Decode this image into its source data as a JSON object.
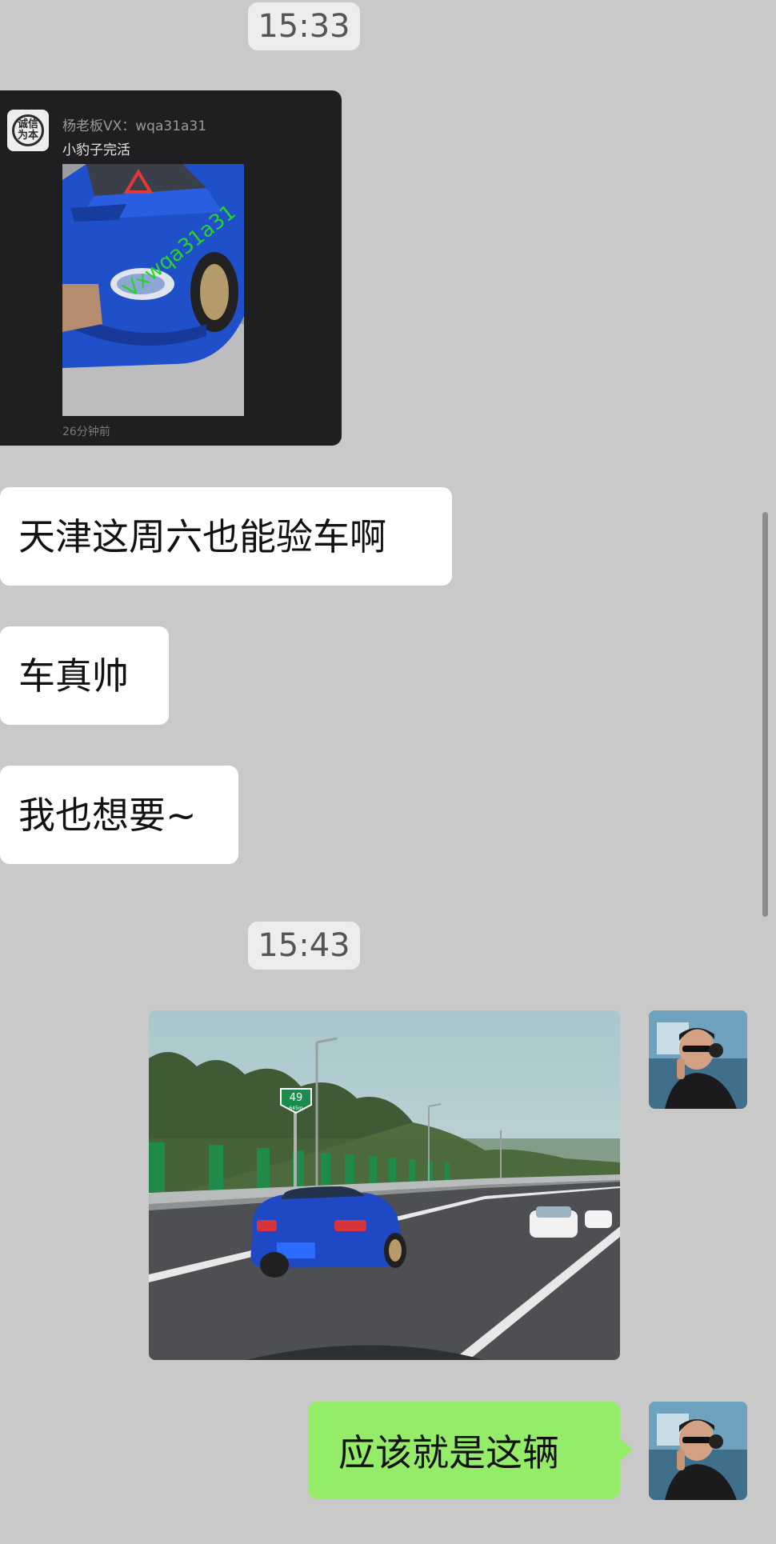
{
  "chat": {
    "time1": "15:33",
    "forward": {
      "logo_text": "诚信为本",
      "sender": "杨老板VX：wqa31a31",
      "message": "小豹子完活",
      "watermark": "Vxwqa31a31",
      "time_ago": "26分钟前"
    },
    "msg1": "天津这周六也能验车啊",
    "msg2": "车真帅",
    "msg3": "我也想要~",
    "time2": "15:43",
    "road_sign": "49",
    "road_sign_sub": "645m",
    "msg4": "应该就是这辆"
  },
  "colors": {
    "background": "#c9c9c9",
    "bubble_incoming": "#ffffff",
    "bubble_outgoing": "#95ec69",
    "card_background": "#1f1f21"
  }
}
